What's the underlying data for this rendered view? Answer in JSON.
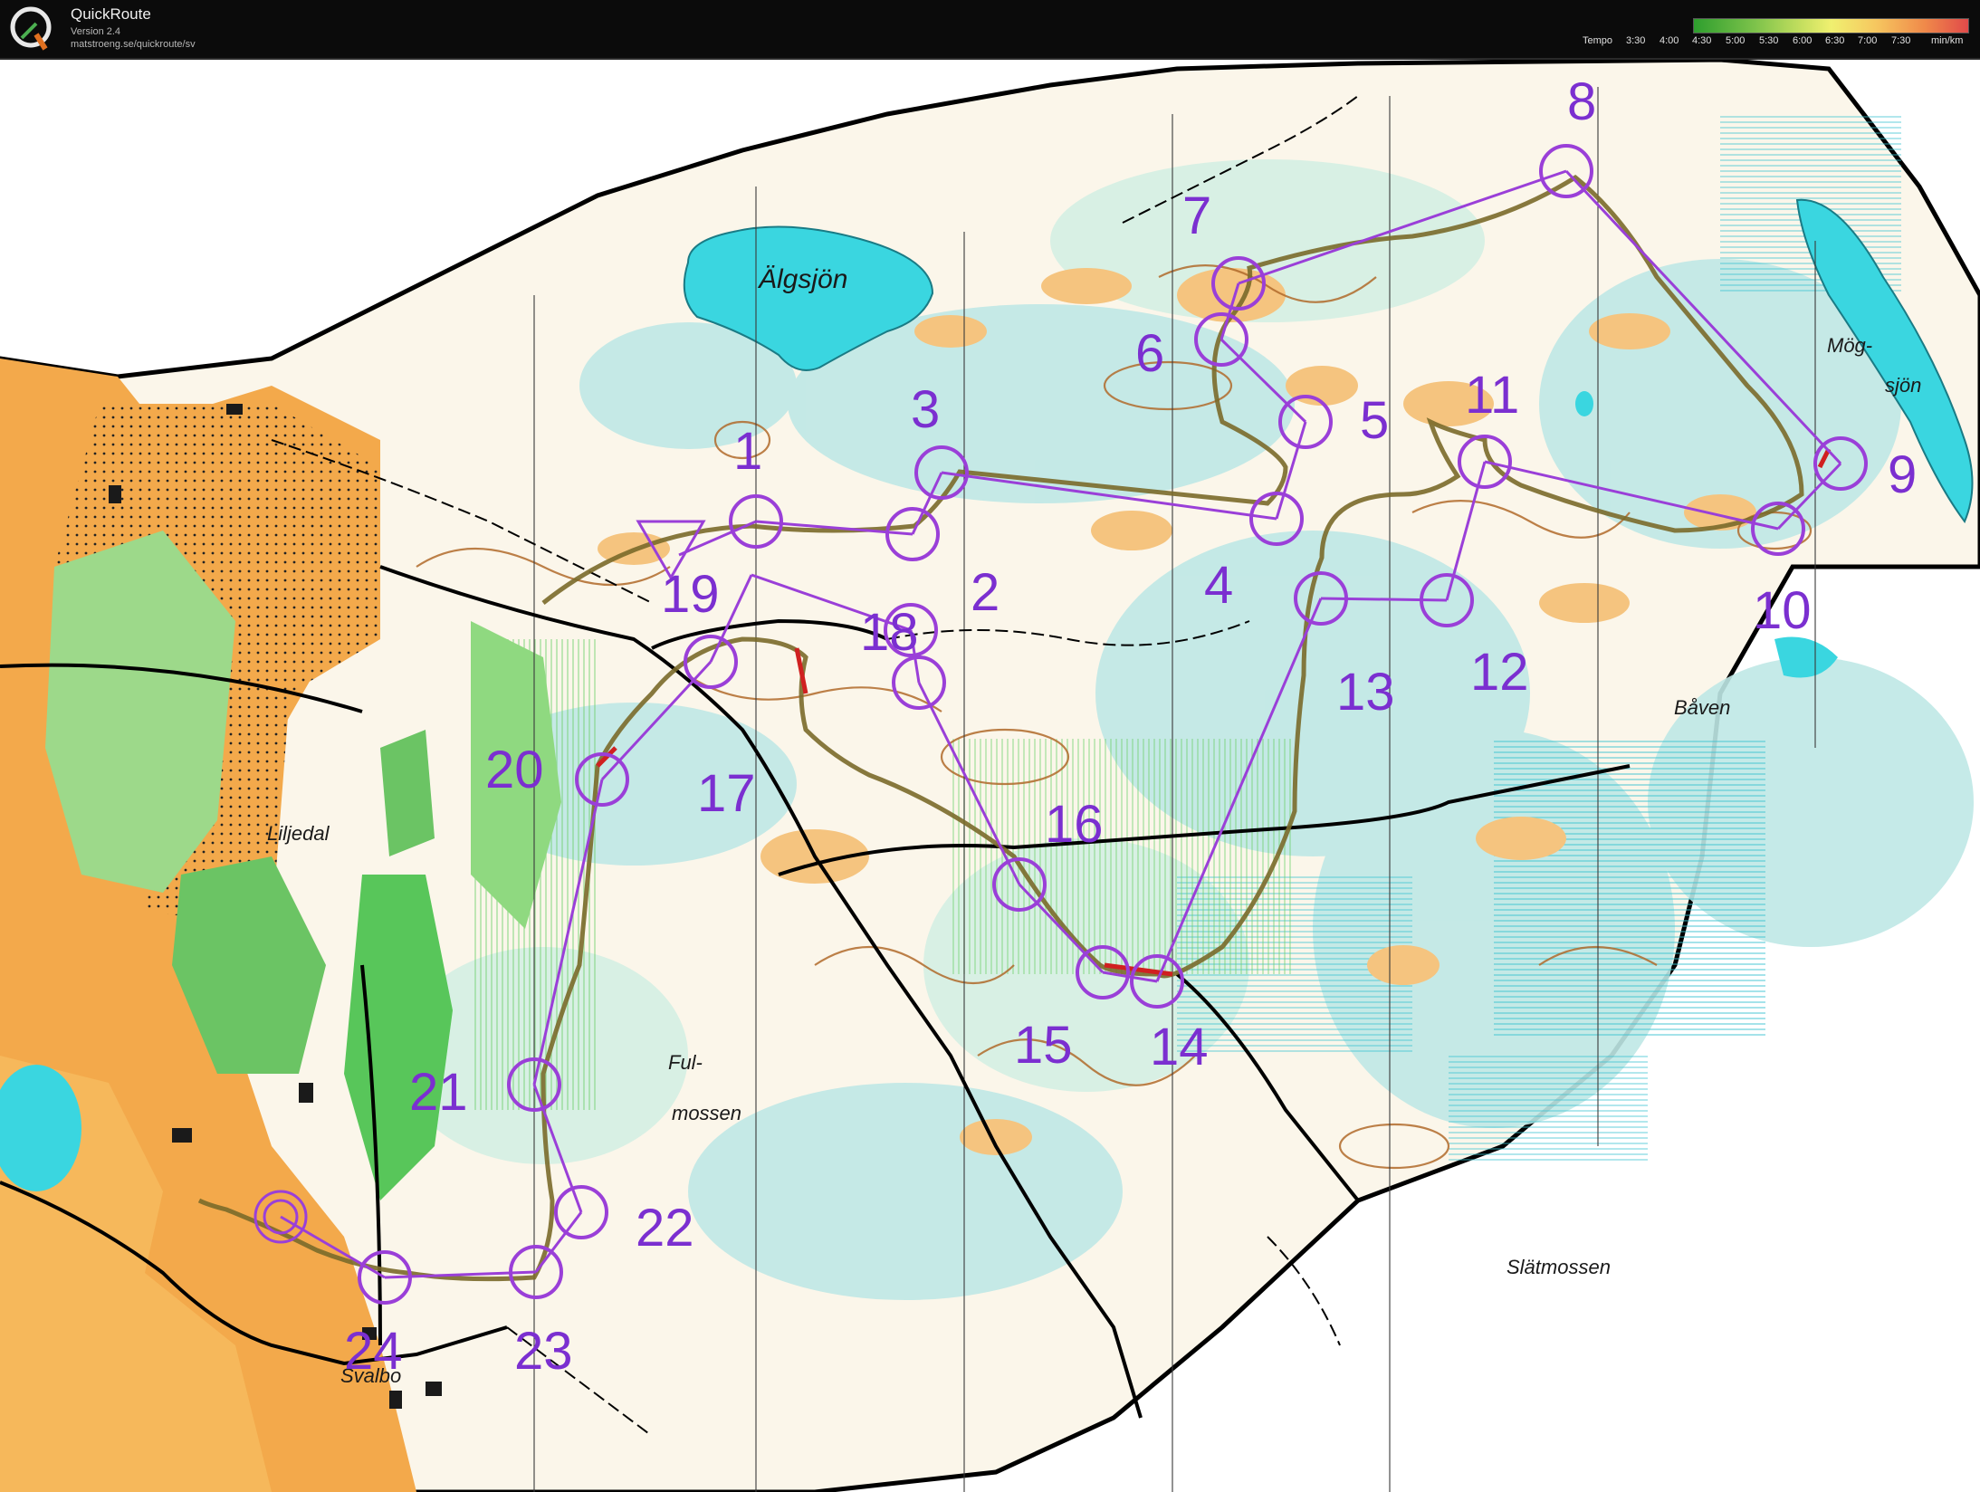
{
  "app": {
    "title": "QuickRoute",
    "version": "Version 2.4",
    "url": "matstroeng.se/quickroute/sv"
  },
  "tempo": {
    "label": "Tempo",
    "ticks": [
      "3:30",
      "4:00",
      "4:30",
      "5:00",
      "5:30",
      "6:00",
      "6:30",
      "7:00",
      "7:30"
    ],
    "unit": "min/km"
  },
  "colors": {
    "course": "#9a3fd8",
    "route": "#7a6a2a",
    "water": "#3ad6e0",
    "open_land": "#f3a94b",
    "green": "#58c65a"
  },
  "places": {
    "algsjon": "Älgsjön",
    "mog": "Mög-",
    "sjon": "sjön",
    "baven": "Båven",
    "liljedal": "Liljedal",
    "ful": "Ful-",
    "mossen": "mossen",
    "slatmossen": "Slätmossen",
    "svalbo": "Svalbo"
  },
  "controls": [
    "1",
    "2",
    "3",
    "4",
    "5",
    "6",
    "7",
    "8",
    "9",
    "10",
    "11",
    "12",
    "13",
    "14",
    "15",
    "16",
    "17",
    "18",
    "19",
    "20",
    "21",
    "22",
    "23",
    "24"
  ]
}
